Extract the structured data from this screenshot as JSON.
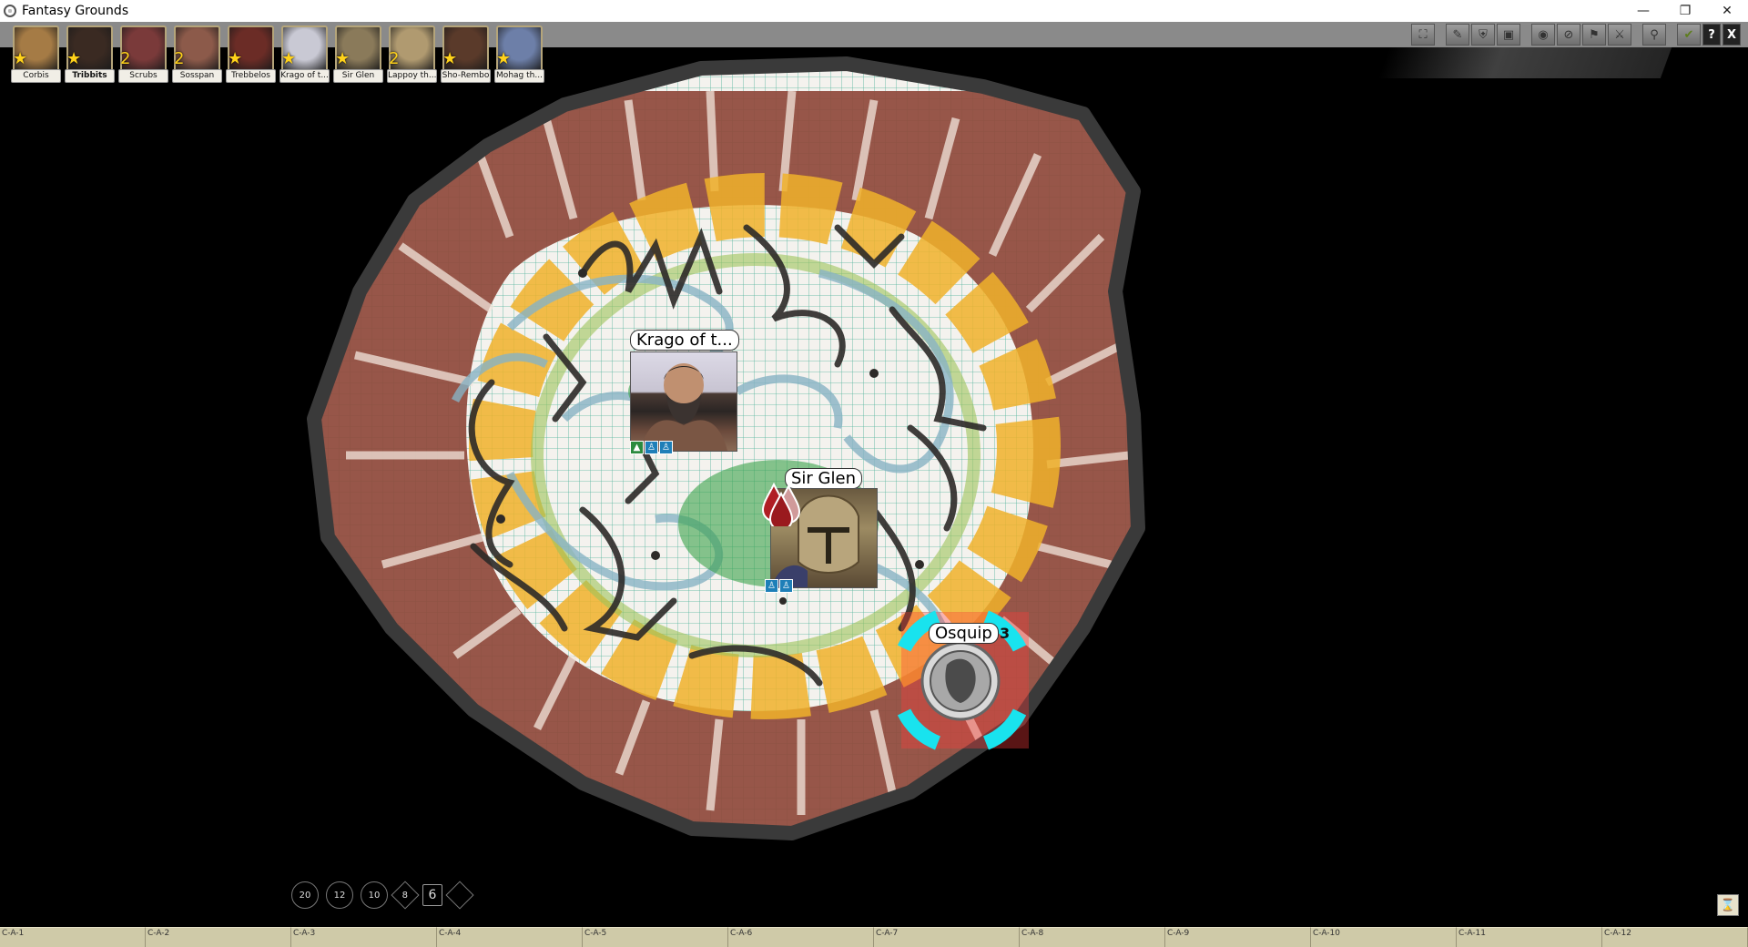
{
  "window": {
    "title": "Fantasy Grounds",
    "controls": [
      "minimize-icon",
      "restore-icon",
      "close-icon"
    ]
  },
  "toolbar": {
    "buttons": [
      {
        "icon": "fullscreen-icon"
      },
      {
        "icon": "pen-icon"
      },
      {
        "icon": "shield-icon"
      },
      {
        "icon": "target-select-icon"
      },
      {
        "icon": "eye-icon"
      },
      {
        "icon": "no-eye-icon"
      },
      {
        "icon": "flag-icon"
      },
      {
        "icon": "crossed-swords-icon"
      },
      {
        "icon": "pin-icon"
      }
    ],
    "right_buttons": [
      {
        "icon": "check-icon"
      },
      {
        "icon": "help-icon",
        "glyph": "?"
      },
      {
        "icon": "close-icon",
        "glyph": "X"
      }
    ]
  },
  "party": [
    {
      "name": "Corbis",
      "bold": false,
      "badge": "★",
      "color": "#a57b45"
    },
    {
      "name": "Tribbits",
      "bold": true,
      "badge": "★",
      "color": "#3a2a22"
    },
    {
      "name": "Scrubs",
      "bold": false,
      "badge": "2",
      "color": "#7a3a3a"
    },
    {
      "name": "Sosspan",
      "bold": false,
      "badge": "2",
      "color": "#8c5a4a"
    },
    {
      "name": "Trebbelos",
      "bold": false,
      "badge": "★",
      "color": "#6b2c26"
    },
    {
      "name": "Krago of t...",
      "bold": false,
      "badge": "★",
      "color": "#c9c9d4"
    },
    {
      "name": "Sir Glen",
      "bold": false,
      "badge": "★",
      "color": "#8a7a5a"
    },
    {
      "name": "Lappoy th...",
      "bold": false,
      "badge": "2",
      "color": "#b09a70"
    },
    {
      "name": "Sho-Rembo",
      "bold": false,
      "badge": "★",
      "color": "#5a3a2a"
    },
    {
      "name": "Mohag th...",
      "bold": false,
      "badge": "★",
      "color": "#6d7fa8"
    }
  ],
  "tokens": {
    "krago": {
      "label": "Krago of t...",
      "effects": [
        "g",
        "b",
        "b"
      ]
    },
    "sirglen": {
      "label": "Sir Glen",
      "effects": [
        "b",
        "b"
      ]
    },
    "osquip": {
      "label": "Osquip",
      "count": "3"
    }
  },
  "dice": [
    {
      "type": "d20",
      "label": "20"
    },
    {
      "type": "d12",
      "label": "12"
    },
    {
      "type": "d10",
      "label": "10"
    },
    {
      "type": "d8",
      "label": "8"
    },
    {
      "type": "d6",
      "label": "6"
    },
    {
      "type": "d4",
      "label": ""
    }
  ],
  "hotkeys": [
    "C-A-1",
    "C-A-2",
    "C-A-3",
    "C-A-4",
    "C-A-5",
    "C-A-6",
    "C-A-7",
    "C-A-8",
    "C-A-9",
    "C-A-10",
    "C-A-11",
    "C-A-12"
  ],
  "colors": {
    "background": "#000000",
    "map_outer": "#8f4a3c",
    "map_inner_yellow": "#f0b22a",
    "map_blue": "#8fb6c4",
    "map_outline": "#3a3a3a",
    "targeting_ring": "#19e3ee",
    "hotkey_bar": "#cfcaa8"
  }
}
